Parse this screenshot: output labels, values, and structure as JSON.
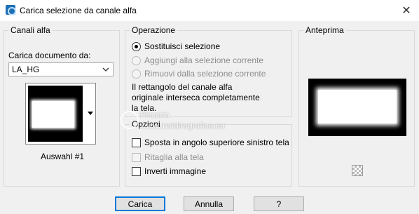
{
  "window": {
    "title": "Carica selezione da canale alfa",
    "close_glyph": "✕",
    "icon": "app-icon"
  },
  "channels": {
    "group_label": "Canali alfa",
    "load_from_label": "Carica documento da:",
    "document_value": "LA_HG",
    "channel_name": "Auswahl #1"
  },
  "operation": {
    "group_label": "Operazione",
    "options": [
      {
        "label": "Sostituisci selezione",
        "checked": true,
        "enabled": true
      },
      {
        "label": "Aggiungi alla selezione corrente",
        "checked": false,
        "enabled": false
      },
      {
        "label": "Rimuovi dalla selezione corrente",
        "checked": false,
        "enabled": false
      }
    ],
    "info_line1": "Il rettangolo del canale alfa",
    "info_line2": "originale interseca completamente",
    "info_line3": "la tela."
  },
  "options": {
    "group_label": "Opzioni",
    "items": [
      {
        "label": "Sposta in angolo superiore sinistro tela",
        "checked": false,
        "enabled": true
      },
      {
        "label": "Ritaglia alla tela",
        "checked": false,
        "enabled": false
      },
      {
        "label": "Inverti immagine",
        "checked": false,
        "enabled": true
      }
    ]
  },
  "preview": {
    "group_label": "Anteprima"
  },
  "watermark": {
    "line1": "Pinuccia",
    "line2": "www.maldiregrafica.eu"
  },
  "buttons": {
    "load": "Carica",
    "cancel": "Annulla",
    "help": "?"
  }
}
